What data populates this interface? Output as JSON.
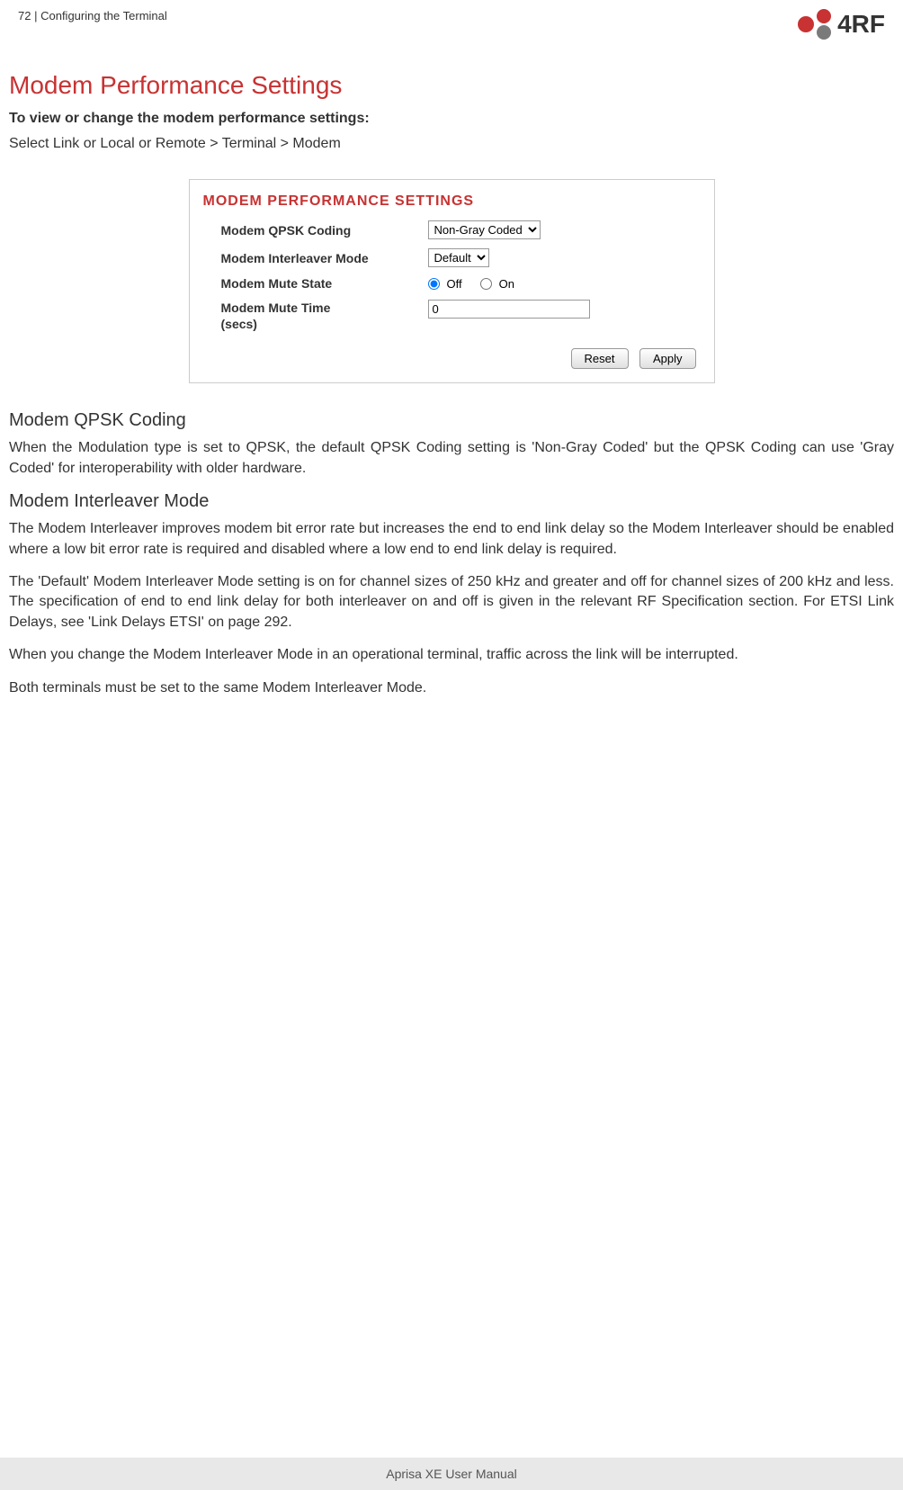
{
  "header": {
    "page_num": "72",
    "section": "Configuring the Terminal",
    "logo_text": "4RF"
  },
  "main": {
    "title": "Modem Performance Settings",
    "subtitle": "To view or change the modem performance settings:",
    "nav_path": "Select Link or Local or Remote > Terminal > Modem"
  },
  "panel": {
    "title": "MODEM PERFORMANCE SETTINGS",
    "qpsk_label": "Modem QPSK Coding",
    "qpsk_value": "Non-Gray Coded",
    "interleaver_label": "Modem Interleaver Mode",
    "interleaver_value": "Default",
    "mute_state_label": "Modem Mute State",
    "mute_off": "Off",
    "mute_on": "On",
    "mute_time_label_1": "Modem Mute Time",
    "mute_time_label_2": "(secs)",
    "mute_time_value": "0",
    "reset_btn": "Reset",
    "apply_btn": "Apply"
  },
  "sections": {
    "qpsk_title": "Modem QPSK Coding",
    "qpsk_text": "When the Modulation type is set to QPSK, the default QPSK Coding setting is 'Non-Gray Coded' but the QPSK Coding can use 'Gray Coded' for interoperability with older hardware.",
    "interleaver_title": "Modem Interleaver Mode",
    "interleaver_p1": "The Modem Interleaver improves modem bit error rate but increases the end to end link delay so the Modem Interleaver should be enabled where a low bit error rate is required and disabled where a low end to end link delay is required.",
    "interleaver_p2": "The 'Default' Modem Interleaver Mode setting is on for channel sizes of 250 kHz and greater and off for channel sizes of 200 kHz and less. The specification of end to end link delay for both interleaver on and off is given in the relevant RF Specification section. For ETSI Link Delays, see 'Link Delays ETSI' on page 292.",
    "interleaver_p3": "When you change the Modem Interleaver Mode in an operational terminal, traffic across the link will be interrupted.",
    "interleaver_p4": "Both terminals must be set to the same Modem Interleaver Mode."
  },
  "footer": {
    "text": "Aprisa XE User Manual"
  }
}
